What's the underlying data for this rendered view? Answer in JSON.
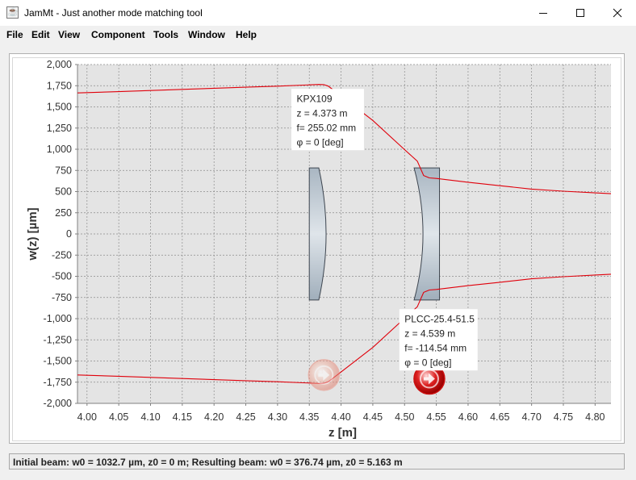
{
  "window": {
    "title": "JamMt - Just another mode matching tool",
    "app_icon": "java-cup-icon",
    "controls": [
      "minimize-icon",
      "maximize-icon",
      "close-icon"
    ]
  },
  "menu": {
    "items": [
      "File",
      "Edit",
      "View",
      "Component",
      "Tools",
      "Window",
      "Help"
    ]
  },
  "chart_data": {
    "type": "line",
    "xlabel": "z [m]",
    "ylabel": "w(z) [µm]",
    "xlim": [
      3.985,
      4.825
    ],
    "ylim": [
      -2000,
      2000
    ],
    "x_ticks": [
      "4.00",
      "4.05",
      "4.10",
      "4.15",
      "4.20",
      "4.25",
      "4.30",
      "4.35",
      "4.40",
      "4.45",
      "4.50",
      "4.55",
      "4.60",
      "4.65",
      "4.70",
      "4.75",
      "4.80"
    ],
    "y_ticks": [
      "2,000",
      "1,750",
      "1,500",
      "1,250",
      "1,000",
      "750",
      "500",
      "250",
      "0",
      "-250",
      "-500",
      "-750",
      "-1,000",
      "-1,250",
      "-1,500",
      "-1,750",
      "-2,000"
    ],
    "grid": true,
    "background": "#e4e4e4",
    "series": [
      {
        "color": "#e0000b",
        "points": [
          [
            3.985,
            1665
          ],
          [
            4.05,
            1680
          ],
          [
            4.1,
            1693
          ],
          [
            4.15,
            1707
          ],
          [
            4.2,
            1720
          ],
          [
            4.25,
            1732
          ],
          [
            4.3,
            1745
          ],
          [
            4.35,
            1760
          ],
          [
            4.365,
            1765
          ],
          [
            4.373,
            1763
          ],
          [
            4.38,
            1745
          ],
          [
            4.4,
            1630
          ],
          [
            4.45,
            1340
          ],
          [
            4.5,
            995
          ],
          [
            4.52,
            860
          ],
          [
            4.53,
            690
          ],
          [
            4.539,
            662
          ],
          [
            4.55,
            655
          ],
          [
            4.6,
            610
          ],
          [
            4.65,
            570
          ],
          [
            4.7,
            530
          ],
          [
            4.75,
            505
          ],
          [
            4.8,
            485
          ],
          [
            4.825,
            475
          ]
        ]
      },
      {
        "color": "#e0000b",
        "points": [
          [
            3.985,
            -1665
          ],
          [
            4.05,
            -1680
          ],
          [
            4.1,
            -1693
          ],
          [
            4.15,
            -1707
          ],
          [
            4.2,
            -1720
          ],
          [
            4.25,
            -1732
          ],
          [
            4.3,
            -1745
          ],
          [
            4.35,
            -1760
          ],
          [
            4.365,
            -1765
          ],
          [
            4.373,
            -1763
          ],
          [
            4.38,
            -1745
          ],
          [
            4.4,
            -1630
          ],
          [
            4.45,
            -1340
          ],
          [
            4.5,
            -995
          ],
          [
            4.52,
            -860
          ],
          [
            4.53,
            -690
          ],
          [
            4.539,
            -662
          ],
          [
            4.55,
            -655
          ],
          [
            4.6,
            -610
          ],
          [
            4.65,
            -570
          ],
          [
            4.7,
            -530
          ],
          [
            4.75,
            -505
          ],
          [
            4.8,
            -485
          ],
          [
            4.825,
            -475
          ]
        ]
      }
    ],
    "lenses": [
      {
        "name": "KPX109",
        "kind": "plano-convex",
        "z": 4.373,
        "z_range": [
          4.35,
          4.37
        ],
        "aperture": 780,
        "label_lines": [
          "KPX109",
          "z = 4.373 m",
          "f= 255.02 mm",
          "φ = 0 [deg]"
        ],
        "label_anchor_data": [
          4.33,
          1555
        ]
      },
      {
        "name": "PLCC-25.4-51.5",
        "kind": "plano-concave",
        "z": 4.539,
        "z_range": [
          4.515,
          4.555
        ],
        "aperture": 780,
        "label_lines": [
          "PLCC-25.4-51.5",
          "z = 4.539 m",
          "f= -114.54 mm",
          "φ = 0 [deg]"
        ],
        "label_anchor_data": [
          4.5,
          -1045
        ]
      }
    ],
    "markers": [
      {
        "name": "waist-marker-initial",
        "z": 4.373,
        "w": -1665,
        "color": "#e88c7c",
        "opacity": 0.55
      },
      {
        "name": "waist-marker-resulting",
        "z": 4.539,
        "w": -1710,
        "color": "#cc1010",
        "opacity": 1
      }
    ]
  },
  "status": {
    "text": "Initial beam: w0 = 1032.7 µm, z0 = 0 m; Resulting beam: w0 = 376.74 µm, z0 = 5.163 m"
  }
}
